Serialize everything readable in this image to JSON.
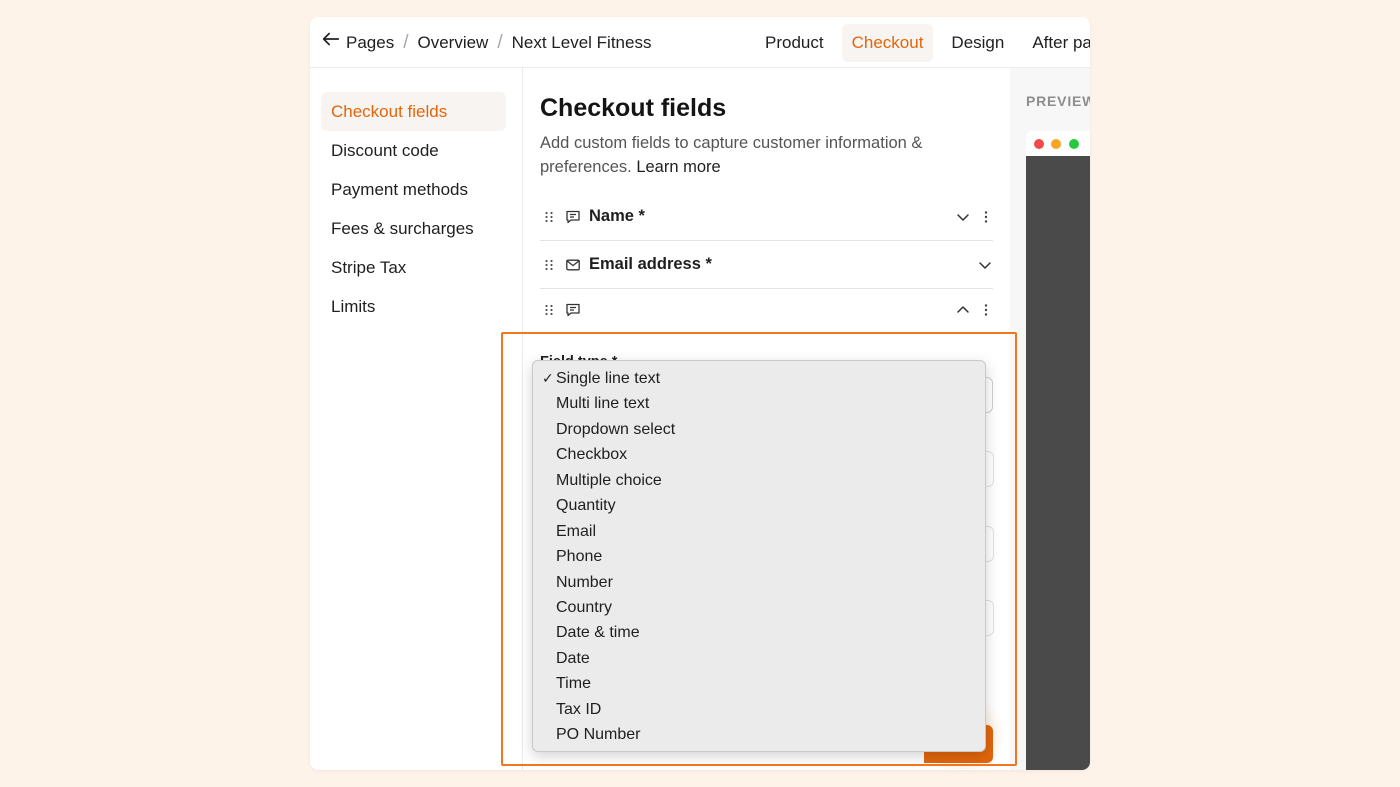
{
  "breadcrumb": {
    "items": [
      "Pages",
      "Overview",
      "Next Level Fitness"
    ],
    "separator": "/"
  },
  "tabs": [
    {
      "label": "Product",
      "active": false
    },
    {
      "label": "Checkout",
      "active": true
    },
    {
      "label": "Design",
      "active": false
    },
    {
      "label": "After pa",
      "active": false
    }
  ],
  "sidebar": {
    "items": [
      {
        "label": "Checkout fields",
        "active": true
      },
      {
        "label": "Discount code",
        "active": false
      },
      {
        "label": "Payment methods",
        "active": false
      },
      {
        "label": "Fees & surcharges",
        "active": false
      },
      {
        "label": "Stripe Tax",
        "active": false
      },
      {
        "label": "Limits",
        "active": false
      }
    ]
  },
  "main": {
    "title": "Checkout fields",
    "description": "Add custom fields to capture customer information & preferences.",
    "learn_more": "Learn more",
    "fields": [
      {
        "label": "Name *",
        "icon": "message-icon",
        "expanded": false
      },
      {
        "label": "Email address *",
        "icon": "envelope-icon",
        "expanded": false
      },
      {
        "label": "",
        "icon": "message-icon",
        "expanded": true
      }
    ],
    "field_type_label": "Field type *"
  },
  "dropdown": {
    "selected": "Single line text",
    "check_glyph": "✓",
    "options": [
      "Single line text",
      "Multi line text",
      "Dropdown select",
      "Checkbox",
      "Multiple choice",
      "Quantity",
      "Email",
      "Phone",
      "Number",
      "Country",
      "Date & time",
      "Date",
      "Time",
      "Tax ID",
      "PO Number"
    ]
  },
  "preview": {
    "label": "PREVIEW"
  },
  "colors": {
    "accent": "#e2660c",
    "highlight_border": "#f2761d",
    "background": "#fdf3e9",
    "preview_body": "#4a4a4a",
    "dot_red": "#f04b4b",
    "dot_yellow": "#f5a623",
    "dot_green": "#27c93f"
  }
}
